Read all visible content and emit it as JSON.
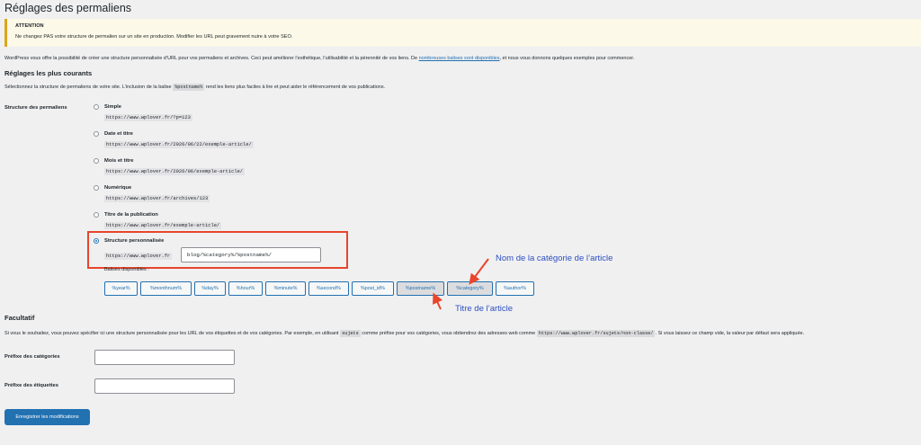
{
  "page": {
    "title": "Réglages des permaliens"
  },
  "notice": {
    "title": "ATTENTION",
    "text": "Ne changez PAS votre structure de permalien sur un site en production. Modifier les URL peut gravement nuire à votre SEO."
  },
  "intro": {
    "text_before": "WordPress vous offre la possibilité de créer une structure personnalisée d’URL pour vos permaliens et archives. Ceci peut améliorer l’esthétique, l’utilisabilité et la pérennité de vos liens. De ",
    "link": "nombreuses balises sont disponibles",
    "text_after": ", et nous vous donnons quelques exemples pour commencer."
  },
  "common": {
    "heading": "Réglages les plus courants",
    "desc_before": "Sélectionnez la structure de permaliens de votre site. L’inclusion de la balise ",
    "desc_code": "%postname%",
    "desc_after": " rend les liens plus faciles à lire et peut aider le référencement de vos publications.",
    "structure_label": "Structure des permaliens",
    "options": [
      {
        "label": "Simple",
        "example": "https://www.wplover.fr/?p=123",
        "selected": false
      },
      {
        "label": "Date et titre",
        "example": "https://www.wplover.fr/2026/06/22/exemple-article/",
        "selected": false
      },
      {
        "label": "Mois et titre",
        "example": "https://www.wplover.fr/2026/06/exemple-article/",
        "selected": false
      },
      {
        "label": "Numérique",
        "example": "https://www.wplover.fr/archives/123",
        "selected": false
      },
      {
        "label": "Titre de la publication",
        "example": "https://www.wplover.fr/exemple-article/",
        "selected": false
      }
    ],
    "custom": {
      "label": "Structure personnalisée",
      "prefix": "https://www.wplover.fr",
      "value": "blog/%category%/%postname%/",
      "selected": true
    },
    "tags_label": "Balises disponibles :",
    "tags": [
      {
        "label": "%year%",
        "active": false
      },
      {
        "label": "%monthnum%",
        "active": false
      },
      {
        "label": "%day%",
        "active": false
      },
      {
        "label": "%hour%",
        "active": false
      },
      {
        "label": "%minute%",
        "active": false
      },
      {
        "label": "%second%",
        "active": false
      },
      {
        "label": "%post_id%",
        "active": false
      },
      {
        "label": "%postname%",
        "active": true
      },
      {
        "label": "%category%",
        "active": true
      },
      {
        "label": "%author%",
        "active": false
      }
    ]
  },
  "annotations": {
    "category": "Nom de la catégorie de l’article",
    "title": "Titre de l’article",
    "color": "#e8452c"
  },
  "optional": {
    "heading": "Facultatif",
    "desc_before": "Si vous le souhaitez, vous pouvez spécifier ici une structure personnalisée pour les URL de vos étiquettes et de vos catégories. Par exemple, en utilisant ",
    "desc_code1": "sujets",
    "desc_mid": " comme préfixe pour vos catégories, vous obtiendrez des adresses web comme ",
    "desc_code2": "https://www.wplover.fr/sujets/non-classe/",
    "desc_after": ". Si vous laissez ce champ vide, la valeur par défaut sera appliquée.",
    "category_prefix_label": "Préfixe des catégories",
    "category_prefix_value": "",
    "tag_prefix_label": "Préfixe des étiquettes",
    "tag_prefix_value": ""
  },
  "save_button": "Enregistrer les modifications",
  "colors": {
    "accent": "#2271b1",
    "notice_border": "#dba617",
    "background": "#f0f0f1"
  }
}
